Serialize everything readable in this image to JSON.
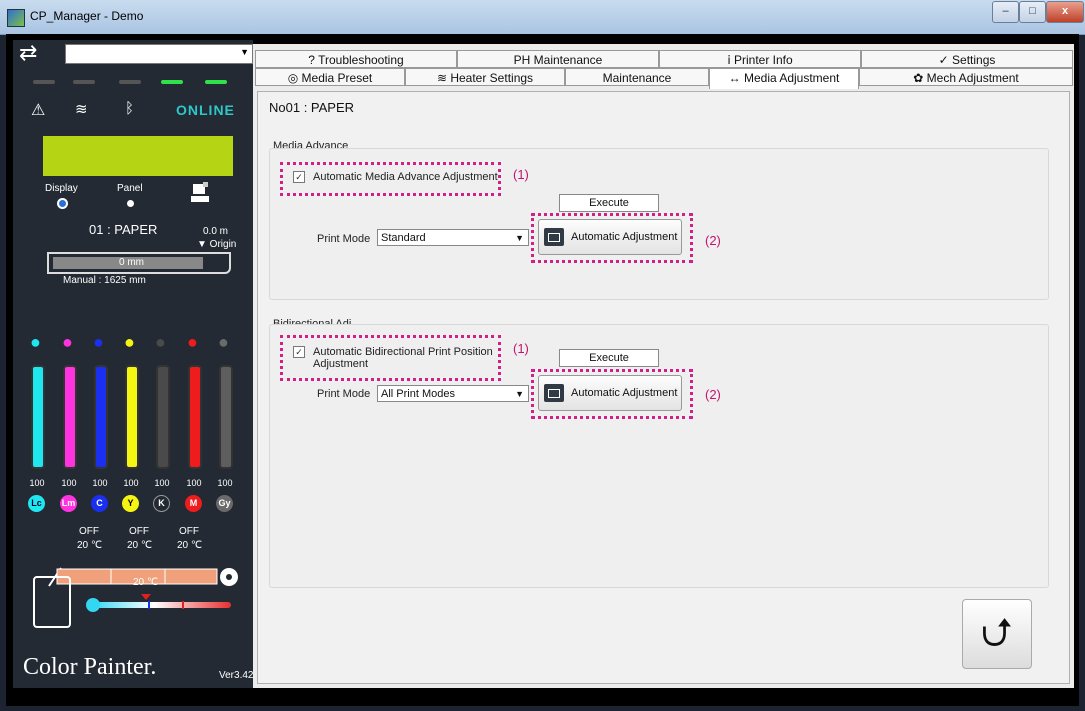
{
  "window": {
    "title": "CP_Manager - Demo",
    "minimize": "–",
    "maximize": "□",
    "close": "x"
  },
  "left": {
    "printer_select": "",
    "status": {
      "warn_icon": "⚠",
      "heater_icon": "≋",
      "ink_icon": "ᛒ",
      "online": "ONLINE"
    },
    "display_label": "Display",
    "panel_label": "Panel",
    "media": {
      "name": "01 : PAPER",
      "length": "0.0  m",
      "origin": "▼ Origin",
      "track_value": "0  mm",
      "manual": "Manual : 1625  mm"
    },
    "inks": [
      {
        "code": "Lc",
        "level": "100",
        "color": "#1ee7f0"
      },
      {
        "code": "Lm",
        "level": "100",
        "color": "#ff33e0"
      },
      {
        "code": "C",
        "level": "100",
        "color": "#1a2ff0"
      },
      {
        "code": "Y",
        "level": "100",
        "color": "#f5f514"
      },
      {
        "code": "K",
        "level": "100",
        "color": "#4a4a4a"
      },
      {
        "code": "M",
        "level": "100",
        "color": "#ee1c1c"
      },
      {
        "code": "Gy",
        "level": "100",
        "color": "#6a6a6a"
      }
    ],
    "heaters": [
      {
        "state": "OFF",
        "temp": "20 ℃"
      },
      {
        "state": "OFF",
        "temp": "20 ℃"
      },
      {
        "state": "OFF",
        "temp": "20 ℃"
      }
    ],
    "ambient_temp": "20 ℃",
    "logo": "Color Painter.",
    "version": "Ver3.42"
  },
  "tabs_top": [
    {
      "label": "?  Troubleshooting"
    },
    {
      "label": "PH Maintenance"
    },
    {
      "label": "ⅰ Printer Info"
    },
    {
      "label": "✓ Settings"
    }
  ],
  "tabs_bottom": [
    {
      "label": "◎ Media Preset"
    },
    {
      "label": "≋ Heater Settings"
    },
    {
      "label": "Maintenance"
    },
    {
      "label": "↔ Media Adjustment"
    },
    {
      "label": "✿ Mech Adjustment"
    }
  ],
  "main": {
    "heading": "No01 : PAPER",
    "media_advance": {
      "title": "Media Advance",
      "checkbox_label": "Automatic Media Advance Adjustment",
      "checked": true,
      "annotation1": "(1)",
      "execute_label": "Execute",
      "print_mode_label": "Print Mode",
      "print_mode_value": "Standard",
      "auto_button": "Automatic Adjustment",
      "annotation2": "(2)"
    },
    "bidirectional": {
      "title": "Bidirectional Adj",
      "checkbox_label_line1": "Automatic Bidirectional Print Position",
      "checkbox_label_line2": "Adjustment",
      "checked": true,
      "annotation1": "(1)",
      "execute_label": "Execute",
      "print_mode_label": "Print Mode",
      "print_mode_value": "All Print Modes",
      "auto_button": "Automatic Adjustment",
      "annotation2": "(2)"
    },
    "apply_icon": "refresh-apply-icon"
  }
}
